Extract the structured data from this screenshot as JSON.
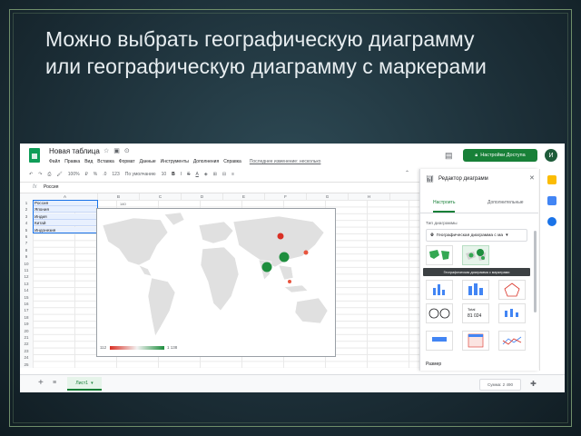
{
  "slide": {
    "title": "Можно выбрать географическую диаграмму\n или географическую диаграмму с маркерами"
  },
  "app": {
    "doc_title": "Новая таблица",
    "menu": [
      "Файл",
      "Правка",
      "Вид",
      "Вставка",
      "Формат",
      "Данные",
      "Инструменты",
      "Дополнения",
      "Справка"
    ],
    "last_edit": "Последнее изменение: несколько",
    "share_label": "Настройки Доступа",
    "avatar_letter": "И",
    "toolbar": {
      "zoom": "100%",
      "currency": "₽",
      "percent": "%",
      "decimals": ".0",
      "more_formats": "123",
      "font": "По умолчанию",
      "font_size": "10",
      "bold": "B",
      "italic": "I",
      "strike": "S",
      "text_color": "A"
    },
    "formula": {
      "fx": "fx",
      "value": "Россия"
    },
    "columns": [
      "A",
      "B",
      "C",
      "D",
      "E",
      "F",
      "G",
      "H"
    ],
    "rows": [
      "1",
      "2",
      "3",
      "4",
      "5",
      "6",
      "7",
      "8",
      "9",
      "10",
      "11",
      "12",
      "13",
      "14",
      "15",
      "16",
      "17",
      "18",
      "19",
      "20",
      "21",
      "22",
      "23",
      "24",
      "25"
    ],
    "cells": [
      "Россия",
      "Япония",
      "Индия",
      "Китай",
      "Индонезия"
    ],
    "chart_cell_label": "140",
    "sheet_tab": "Лист1",
    "sum_label": "Сумма: 2 490",
    "colors": {
      "green": "#188038",
      "accent_blue": "#1a73e8",
      "low": "#d93025",
      "high": "#1e8e3e"
    }
  },
  "chart_data": {
    "type": "geo",
    "legend_min": "112",
    "legend_max": "1 138",
    "markers_for": [
      "Россия",
      "Япония",
      "Индия",
      "Китай",
      "Индонезия"
    ]
  },
  "editor": {
    "title": "Редактор диаграмм",
    "tab_setup": "Настроить",
    "tab_customize": "Дополнительные",
    "chart_type_label": "Тип диаграммы",
    "chart_type_value": "Географическая диаграмма с ма",
    "tooltip": "Географическая диаграмма с маркерами",
    "scorecard_label": "Total",
    "scorecard_value": "81 024",
    "size_label": "Размер"
  }
}
